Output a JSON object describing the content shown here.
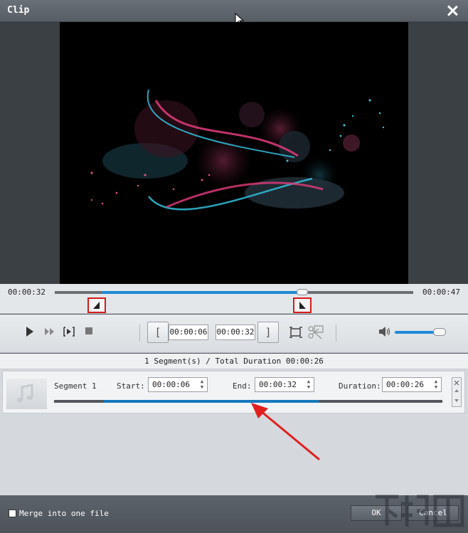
{
  "window": {
    "title": "Clip"
  },
  "timeline": {
    "current_time": "00:00:32",
    "total_time": "00:00:47",
    "selection_start_fraction": 0.13,
    "selection_end_fraction": 0.69
  },
  "trim": {
    "start_time": "00:00:06",
    "end_time": "00:00:32",
    "start_bracket": "[",
    "end_bracket": "]"
  },
  "volume": {
    "level_fraction": 0.88
  },
  "summary": {
    "text": "1 Segment(s) / Total Duration 00:00:26"
  },
  "segments": [
    {
      "name": "Segment 1",
      "start_label": "Start:",
      "start": "00:00:06",
      "end_label": "End:",
      "end": "00:00:32",
      "duration_label": "Duration:",
      "duration": "00:00:26"
    }
  ],
  "footer": {
    "merge_label": "Merge into one file",
    "merge_checked": false,
    "ok_label": "OK",
    "cancel_label": "Cancel"
  },
  "colors": {
    "accent": "#1e8bd4",
    "highlight_box": "#d61a1a",
    "arrow": "#e02020"
  },
  "icons": [
    "close-icon",
    "play-icon",
    "fast-forward-icon",
    "step-frame-icon",
    "stop-icon",
    "crop-icon",
    "cut-icon",
    "volume-icon",
    "music-note-icon"
  ]
}
